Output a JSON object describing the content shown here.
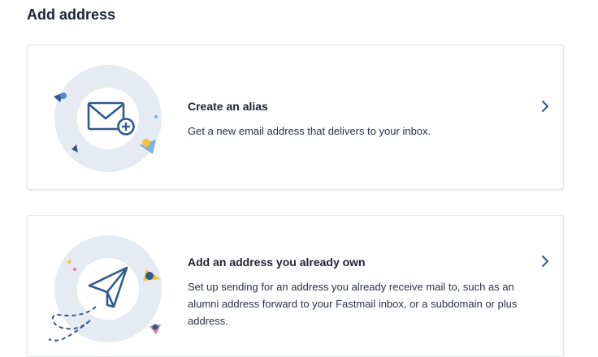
{
  "page": {
    "title": "Add address"
  },
  "options": [
    {
      "title": "Create an alias",
      "description": "Get a new email address that delivers to your inbox.",
      "icon": "envelope-plus-icon"
    },
    {
      "title": "Add an address you already own",
      "description": "Set up sending for an address you already receive mail to, such as an alumni address forward to your Fastmail inbox, or a subdomain or plus address.",
      "icon": "paper-plane-icon"
    }
  ],
  "colors": {
    "accent": "#2f5a8e",
    "circle_outer": "#e6ebf3",
    "yellow": "#f5c33b",
    "light_blue": "#7fb0e0"
  }
}
